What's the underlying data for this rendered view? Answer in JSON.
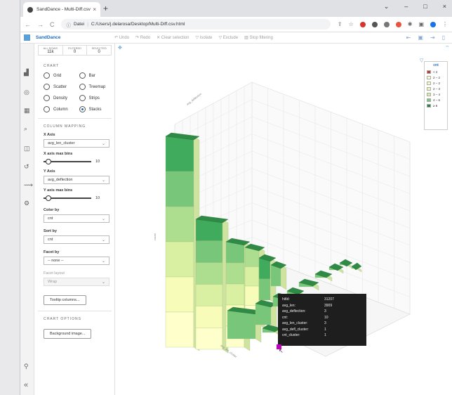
{
  "browser": {
    "tab_title": "SandDance - Multi-Diff.csv",
    "tab_close": "×",
    "new_tab": "+",
    "url_prefix": "Datei",
    "url": "C:/Users/j.delarosa/Desktop/Multi-Diff.csv.html",
    "window_controls": [
      "⌄",
      "–",
      "□",
      "×"
    ]
  },
  "app": {
    "brand": "SandDance",
    "toolbar": [
      "Undo",
      "Redo",
      "Clear selection",
      "Isolate",
      "Exclude",
      "Stop filtering"
    ]
  },
  "counts": [
    {
      "label": "ALL ROWS",
      "value": "11k"
    },
    {
      "label": "FILTERED",
      "value": "0"
    },
    {
      "label": "SELECTED",
      "value": "0"
    }
  ],
  "chart_panel": {
    "title": "CHART",
    "types": [
      "Grid",
      "Bar",
      "Scatter",
      "Treemap",
      "Density",
      "Strips",
      "Column",
      "Stacks"
    ],
    "selected": "Stacks"
  },
  "mapping": {
    "title": "COLUMN MAPPING",
    "x_axis_label": "X Axis",
    "x_axis_value": "avg_len_cluster",
    "x_bins_label": "X axis max bins",
    "x_bins_value": "10",
    "y_axis_label": "Y Axis",
    "y_axis_value": "avg_deflection",
    "y_bins_label": "Y axis max bins",
    "y_bins_value": "10",
    "color_label": "Color by",
    "color_value": "cnt",
    "sort_label": "Sort by",
    "sort_value": "cnt",
    "facet_label": "Facet by",
    "facet_value": "-- none --",
    "facet_layout_label": "Facet layout",
    "facet_layout_value": "Wrap",
    "tooltip_button": "Tooltip columns..."
  },
  "options": {
    "title": "CHART OPTIONS",
    "background_button": "Background image..."
  },
  "legend": {
    "title": "cnt",
    "items": [
      {
        "label": "< 2",
        "color": "#c0392b"
      },
      {
        "label": "2 – 2",
        "color": "#ffffcc"
      },
      {
        "label": "2 – 2",
        "color": "#f7fcb9"
      },
      {
        "label": "2 – 3",
        "color": "#ecf7b1"
      },
      {
        "label": "3 – 4",
        "color": "#d9f0a3"
      },
      {
        "label": "4 – 6",
        "color": "#78c679"
      },
      {
        "label": "≥ 6",
        "color": "#238443"
      }
    ]
  },
  "axes": {
    "x": "avg_len_cluster",
    "y": "avg_deflection",
    "z": "count"
  },
  "tooltip": [
    {
      "k": "hitId:",
      "v": "31207"
    },
    {
      "k": "avg_len:",
      "v": "3909"
    },
    {
      "k": "avg_deflection:",
      "v": "3"
    },
    {
      "k": "cnt:",
      "v": "10"
    },
    {
      "k": "avg_len_cluster:",
      "v": "3"
    },
    {
      "k": "avg_defl_cluster:",
      "v": "1"
    },
    {
      "k": "cnt_cluster:",
      "v": "1"
    }
  ]
}
